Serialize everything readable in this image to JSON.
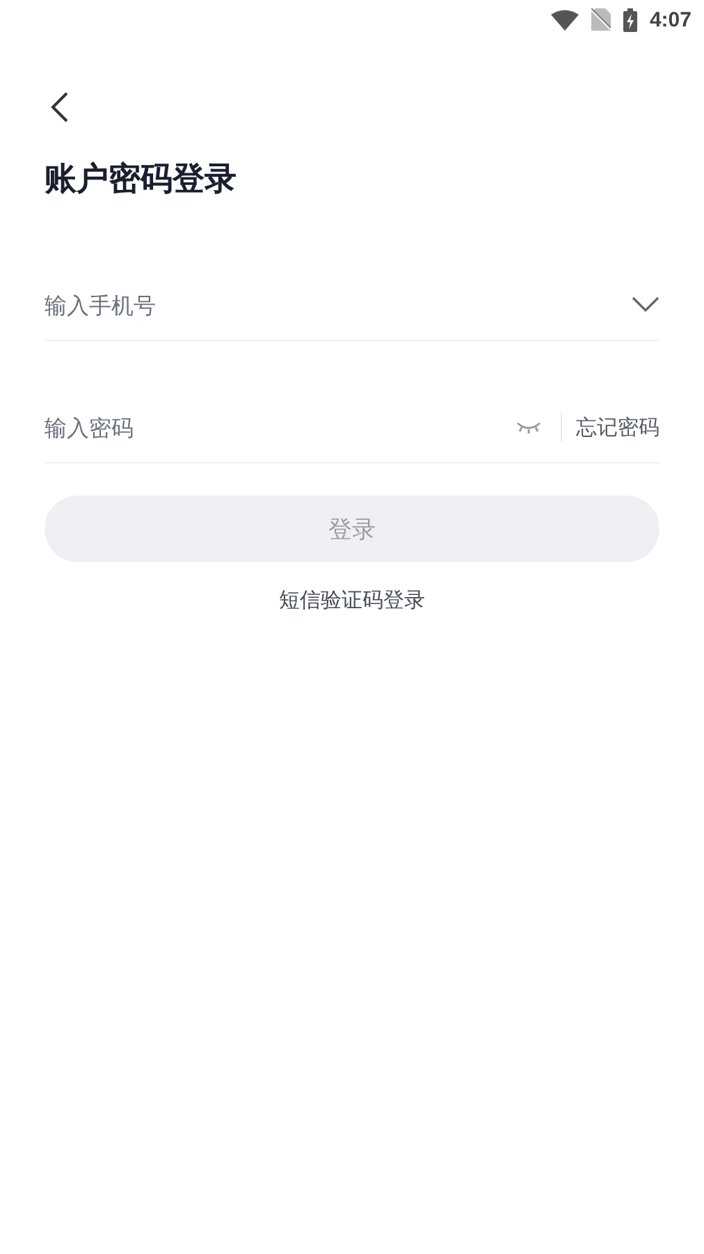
{
  "status_bar": {
    "time": "4:07"
  },
  "title": "账户密码登录",
  "phone_field": {
    "placeholder": "输入手机号"
  },
  "password_field": {
    "placeholder": "输入密码",
    "visible": false
  },
  "forgot_link": "忘记密码",
  "login_button": {
    "label": "登录",
    "disabled": true
  },
  "sms_login_link": "短信验证码登录"
}
